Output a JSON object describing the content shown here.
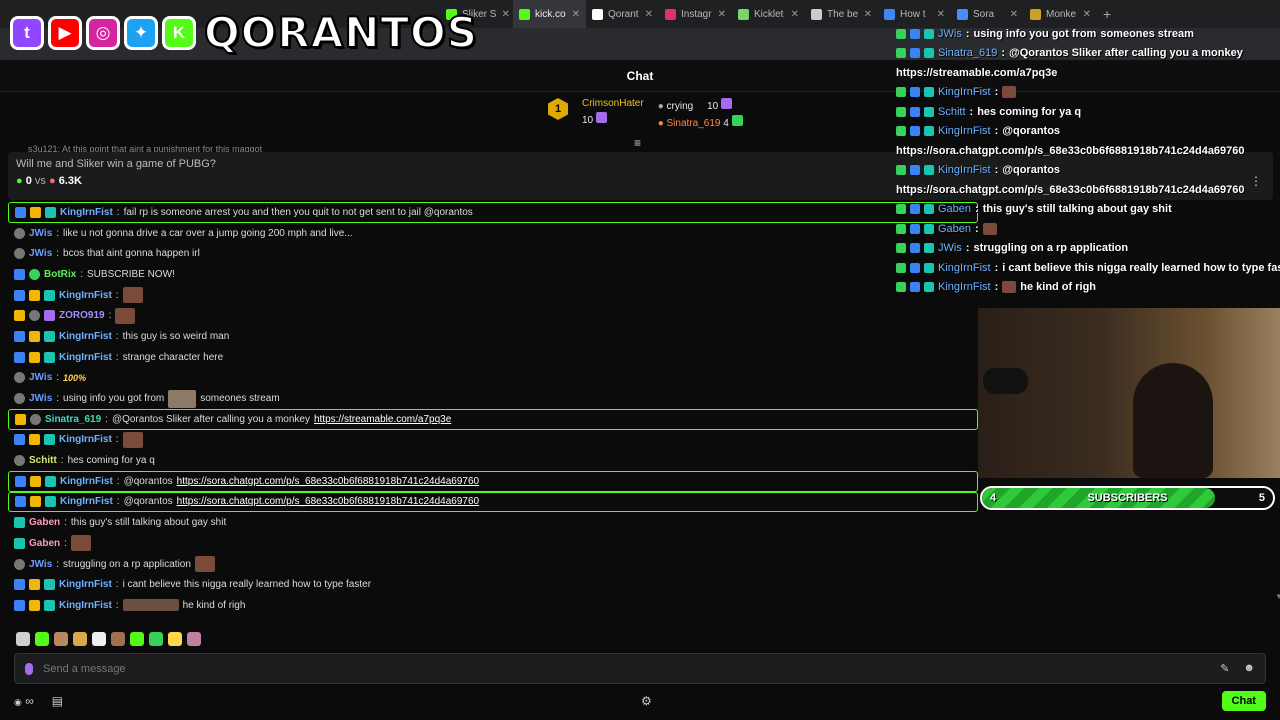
{
  "browser": {
    "tabs": [
      {
        "label": "Sliker S",
        "color": "#53fc18",
        "active": false
      },
      {
        "label": "kick.co",
        "color": "#53fc18",
        "active": true
      },
      {
        "label": "Qorant",
        "color": "#ffffff",
        "active": false
      },
      {
        "label": "Instagr",
        "color": "#e1306c",
        "active": false
      },
      {
        "label": "Kicklet",
        "color": "#7ad36b",
        "active": false
      },
      {
        "label": "The be",
        "color": "#cccccc",
        "active": false
      },
      {
        "label": "How t",
        "color": "#4285f4",
        "active": false
      },
      {
        "label": "Sora",
        "color": "#4a8cff",
        "active": false
      },
      {
        "label": "Monke",
        "color": "#c9a227",
        "active": false
      }
    ],
    "new_tab": "+"
  },
  "overlay": {
    "brand": "QORANTOS",
    "logos": [
      {
        "name": "twitch-logo",
        "color": "#9146ff",
        "glyph": "t"
      },
      {
        "name": "youtube-logo",
        "color": "#ff0000",
        "glyph": "▶"
      },
      {
        "name": "instagram-logo",
        "color": "#d6249f",
        "glyph": "◎"
      },
      {
        "name": "twitter-logo",
        "color": "#1da1f2",
        "glyph": "✦"
      },
      {
        "name": "kick-logo",
        "color": "#53fc18",
        "glyph": "K"
      }
    ]
  },
  "chat": {
    "header": "Chat",
    "leaderboard": {
      "rank": "1",
      "first": {
        "name": "CrimsonHater",
        "count": "10"
      },
      "second": {
        "name": "crying",
        "count": "10"
      },
      "third": {
        "name": "Sinatra_619",
        "count": "4"
      }
    },
    "cutoff_text": "s3u121: At this point that aint a punishment for this maggot",
    "poll": {
      "question": "Will me and Sliker win a game of PUBG?",
      "left_votes": "0",
      "vs": "vs",
      "right_votes": "6.3K"
    },
    "messages": [
      {
        "user": "KingIrnFist",
        "ucls": "u-king",
        "badges": [
          "b-blue",
          "b-crown",
          "b-sub"
        ],
        "text": "fail rp is someone arrest you and then you quit to not get sent to jail @qorantos",
        "hl": true
      },
      {
        "user": "JWis",
        "ucls": "u-jw",
        "badges": [
          "b-gray"
        ],
        "text": "like u not gonna drive a car over a jump going 200 mph and live..."
      },
      {
        "user": "JWis",
        "ucls": "u-jw",
        "badges": [
          "b-gray"
        ],
        "text": "bcos that aint gonna happen irl"
      },
      {
        "user": "BotRix",
        "ucls": "u-bot",
        "badges": [
          "b-blue",
          "b-green"
        ],
        "text": "SUBSCRIBE NOW!"
      },
      {
        "user": "KingIrnFist",
        "ucls": "u-king",
        "badges": [
          "b-blue",
          "b-crown",
          "b-sub"
        ],
        "text": "",
        "emote": "emote"
      },
      {
        "user": "ZORO919",
        "ucls": "u-zoro",
        "badges": [
          "b-crown",
          "b-gray",
          "b-purple"
        ],
        "text": "",
        "emote": "emote"
      },
      {
        "user": "KingIrnFist",
        "ucls": "u-king",
        "badges": [
          "b-blue",
          "b-crown",
          "b-sub"
        ],
        "text": "this guy is so weird man"
      },
      {
        "user": "KingIrnFist",
        "ucls": "u-king",
        "badges": [
          "b-blue",
          "b-crown",
          "b-sub"
        ],
        "text": "strange character here"
      },
      {
        "user": "JWis",
        "ucls": "u-jw",
        "badges": [
          "b-gray"
        ],
        "text": "",
        "emote_text": "100%"
      },
      {
        "user": "JWis",
        "ucls": "u-jw",
        "badges": [
          "b-gray"
        ],
        "text": "using info you got from",
        "emote": "emote cat",
        "after": "someones stream"
      },
      {
        "user": "Sinatra_619",
        "ucls": "u-sin",
        "badges": [
          "b-crown",
          "b-gray"
        ],
        "text": "@Qorantos Sliker after calling you a monkey",
        "link": "https://streamable.com/a7pq3e",
        "hl": true
      },
      {
        "user": "KingIrnFist",
        "ucls": "u-king",
        "badges": [
          "b-blue",
          "b-crown",
          "b-sub"
        ],
        "text": "",
        "emote": "emote"
      },
      {
        "user": "Schitt",
        "ucls": "u-schitt",
        "badges": [
          "b-gray"
        ],
        "text": "hes coming for ya q"
      },
      {
        "user": "KingIrnFist",
        "ucls": "u-king",
        "badges": [
          "b-blue",
          "b-crown",
          "b-sub"
        ],
        "text": "@qorantos",
        "link": "https://sora.chatgpt.com/p/s_68e33c0b6f6881918b741c24d4a69760",
        "hl": true
      },
      {
        "user": "KingIrnFist",
        "ucls": "u-king",
        "badges": [
          "b-blue",
          "b-crown",
          "b-sub"
        ],
        "text": "@qorantos",
        "link": "https://sora.chatgpt.com/p/s_68e33c0b6f6881918b741c24d4a69760",
        "hl": true
      },
      {
        "user": "Gaben",
        "ucls": "u-gaben",
        "badges": [
          "b-sub"
        ],
        "text": "this guy's still talking about gay shit"
      },
      {
        "user": "Gaben",
        "ucls": "u-gaben",
        "badges": [
          "b-sub"
        ],
        "text": "",
        "emote": "emote"
      },
      {
        "user": "JWis",
        "ucls": "u-jw",
        "badges": [
          "b-gray"
        ],
        "text": "struggling on a rp application",
        "emote": "emote"
      },
      {
        "user": "KingIrnFist",
        "ucls": "u-king",
        "badges": [
          "b-blue",
          "b-crown",
          "b-sub"
        ],
        "text": "i cant believe this nigga really learned how to type faster"
      },
      {
        "user": "KingIrnFist",
        "ucls": "u-king",
        "badges": [
          "b-blue",
          "b-crown",
          "b-sub"
        ],
        "text": "",
        "emote": "emote wide",
        "after": "he kind of righ"
      }
    ],
    "emote_bar_colors": [
      "#cfcfcf",
      "#53fc18",
      "#b88860",
      "#d9a84a",
      "#eeeeee",
      "#a07050",
      "#53fc18",
      "#36d35a",
      "#ffd84a",
      "#c080a0"
    ],
    "input_placeholder": "Send a message",
    "footer_infinity": "∞",
    "chat_button": "Chat"
  },
  "overlay_chat": [
    {
      "name": "JWis",
      "text": "using info you got from",
      "after": "someones stream"
    },
    {
      "name": "Sinatra_619",
      "text": "@Qorantos Sliker after calling you a monkey"
    },
    {
      "cont": "https://streamable.com/a7pq3e"
    },
    {
      "name": "KingIrnFist",
      "text": ""
    },
    {
      "name": "Schitt",
      "text": "hes coming for ya q"
    },
    {
      "name": "KingIrnFist",
      "text": "@qorantos"
    },
    {
      "cont": "https://sora.chatgpt.com/p/s_68e33c0b6f6881918b741c24d4a69760"
    },
    {
      "name": "KingIrnFist",
      "text": "@qorantos"
    },
    {
      "cont": "https://sora.chatgpt.com/p/s_68e33c0b6f6881918b741c24d4a69760"
    },
    {
      "name": "Gaben",
      "text": "this guy's still talking about gay shit"
    },
    {
      "name": "Gaben",
      "text": ""
    },
    {
      "name": "JWis",
      "text": "struggling on a rp application"
    },
    {
      "name": "KingIrnFist",
      "text": "i cant believe this nigga really learned how to type faster"
    },
    {
      "name": "KingIrnFist",
      "text": "",
      "after": "he kind of righ"
    }
  ],
  "subscribers": {
    "label": "SUBSCRIBERS",
    "current": "4",
    "goal": "5",
    "progress": 0.8
  }
}
